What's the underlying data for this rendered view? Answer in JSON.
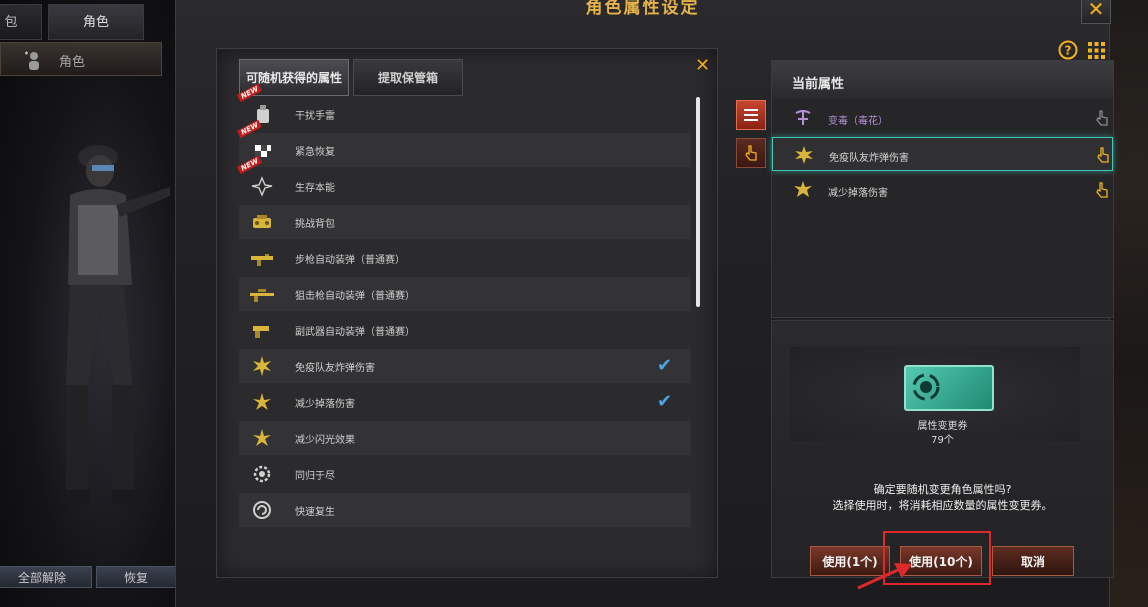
{
  "left": {
    "tab_bag": "包",
    "tab_role": "角色",
    "char_tab_label": "角色",
    "btn_unlock_all": "全部解除",
    "btn_restore": "恢复"
  },
  "dialog": {
    "title": "角色属性设定",
    "close_glyph": "✕"
  },
  "list_panel": {
    "tab_random": "可随机获得的属性",
    "tab_vault": "提取保管箱",
    "close_glyph": "✕",
    "items": [
      {
        "label": "干扰手雷",
        "new": "NEW",
        "checked": false
      },
      {
        "label": "紧急恢复",
        "new": "NEW",
        "checked": false
      },
      {
        "label": "生存本能",
        "new": "NEW",
        "checked": false
      },
      {
        "label": "挑战背包",
        "new": "",
        "checked": false
      },
      {
        "label": "步枪自动装弹（普通赛）",
        "new": "",
        "checked": false
      },
      {
        "label": "狙击枪自动装弹（普通赛）",
        "new": "",
        "checked": false
      },
      {
        "label": "副武器自动装弹（普通赛）",
        "new": "",
        "checked": false
      },
      {
        "label": "免疫队友炸弹伤害",
        "new": "",
        "checked": true
      },
      {
        "label": "减少掉落伤害",
        "new": "",
        "checked": true
      },
      {
        "label": "减少闪光效果",
        "new": "",
        "checked": false
      },
      {
        "label": "同归于尽",
        "new": "",
        "checked": false
      },
      {
        "label": "快速复生",
        "new": "",
        "checked": false
      }
    ],
    "check_glyph": "✔"
  },
  "current": {
    "title": "当前属性",
    "items": [
      {
        "label": "变毒（毒花）"
      },
      {
        "label": "免疫队友炸弹伤害"
      },
      {
        "label": "减少掉落伤害"
      }
    ]
  },
  "ticket": {
    "name": "属性变更券",
    "count": "79个",
    "confirm_line1": "确定要随机变更角色属性吗?",
    "confirm_line2": "选择使用时，将消耗相应数量的属性变更券。",
    "btn_use_1": "使用(1个)",
    "btn_use_10": "使用(10个)",
    "btn_cancel": "取消"
  },
  "top_right": {
    "help_glyph": "?",
    "grid_glyph": "▦"
  },
  "colors": {
    "accent_gold": "#f0b21f",
    "check_blue": "#4aa6e8",
    "select_teal": "#42c4b8",
    "highlight_red": "#e0282a"
  }
}
